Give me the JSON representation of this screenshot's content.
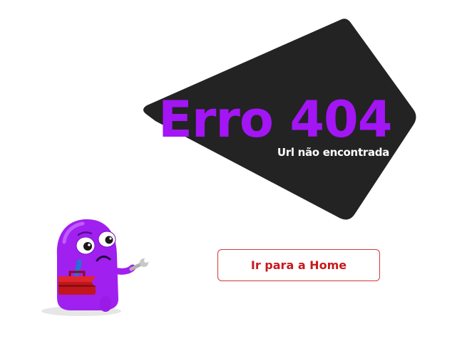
{
  "error": {
    "title": "Erro 404",
    "subtitle": "Url não encontrada"
  },
  "actions": {
    "home_label": "Ir para a Home"
  },
  "colors": {
    "backdrop": "#232323",
    "title": "#a315f5",
    "subtitle": "#ffffff",
    "button_text": "#c8191d",
    "button_border": "#d13a3a",
    "mascot_body": "#a020f0",
    "toolbox": "#c0161c"
  },
  "illustration": {
    "icon": "purple-monster-mechanic-icon"
  }
}
